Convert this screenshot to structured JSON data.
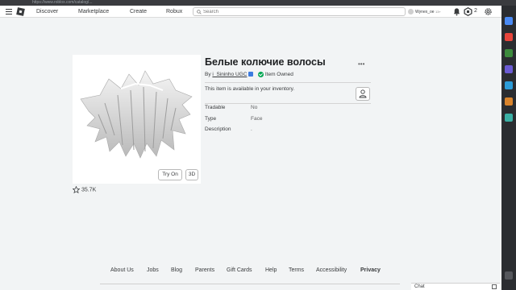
{
  "browser": {
    "url": "https://www.roblox.com/catalog/..."
  },
  "nav": {
    "items": [
      {
        "label": "Discover"
      },
      {
        "label": "Marketplace"
      },
      {
        "label": "Create"
      },
      {
        "label": "Robux"
      }
    ],
    "search_placeholder": "Search",
    "username": "Wynex_oe",
    "user_tag": "13+",
    "robux_balance": "2"
  },
  "item": {
    "title": "Белые колючие волосы",
    "by_prefix": "By",
    "creator": "i_Sininho UGC",
    "owned_label": "Item Owned",
    "inventory_note": "This item is available in your inventory.",
    "try_on_label": "Try On",
    "three_d_label": "3D",
    "favorites": "35.7K",
    "details": [
      {
        "label": "Tradable",
        "value": "No"
      },
      {
        "label": "Type",
        "value": "Face"
      },
      {
        "label": "Description",
        "value": "."
      }
    ]
  },
  "footer": {
    "links": [
      "About Us",
      "Jobs",
      "Blog",
      "Parents",
      "Gift Cards",
      "Help",
      "Terms",
      "Accessibility",
      "Privacy"
    ]
  },
  "chat": {
    "label": "Chat"
  },
  "colors": {
    "page_bg": "#f2f4f5",
    "owned_green": "#00a651",
    "verified_blue": "#3c7be0"
  }
}
